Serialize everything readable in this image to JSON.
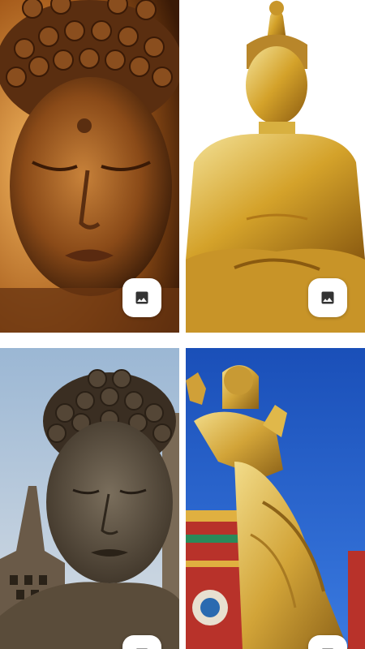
{
  "gallery": {
    "items": [
      {
        "icon": "image-icon"
      },
      {
        "icon": "image-icon"
      },
      {
        "icon": "image-icon"
      },
      {
        "icon": "image-icon"
      }
    ]
  },
  "colors": {
    "button_bg": "#ffffff",
    "icon": "#333333"
  }
}
